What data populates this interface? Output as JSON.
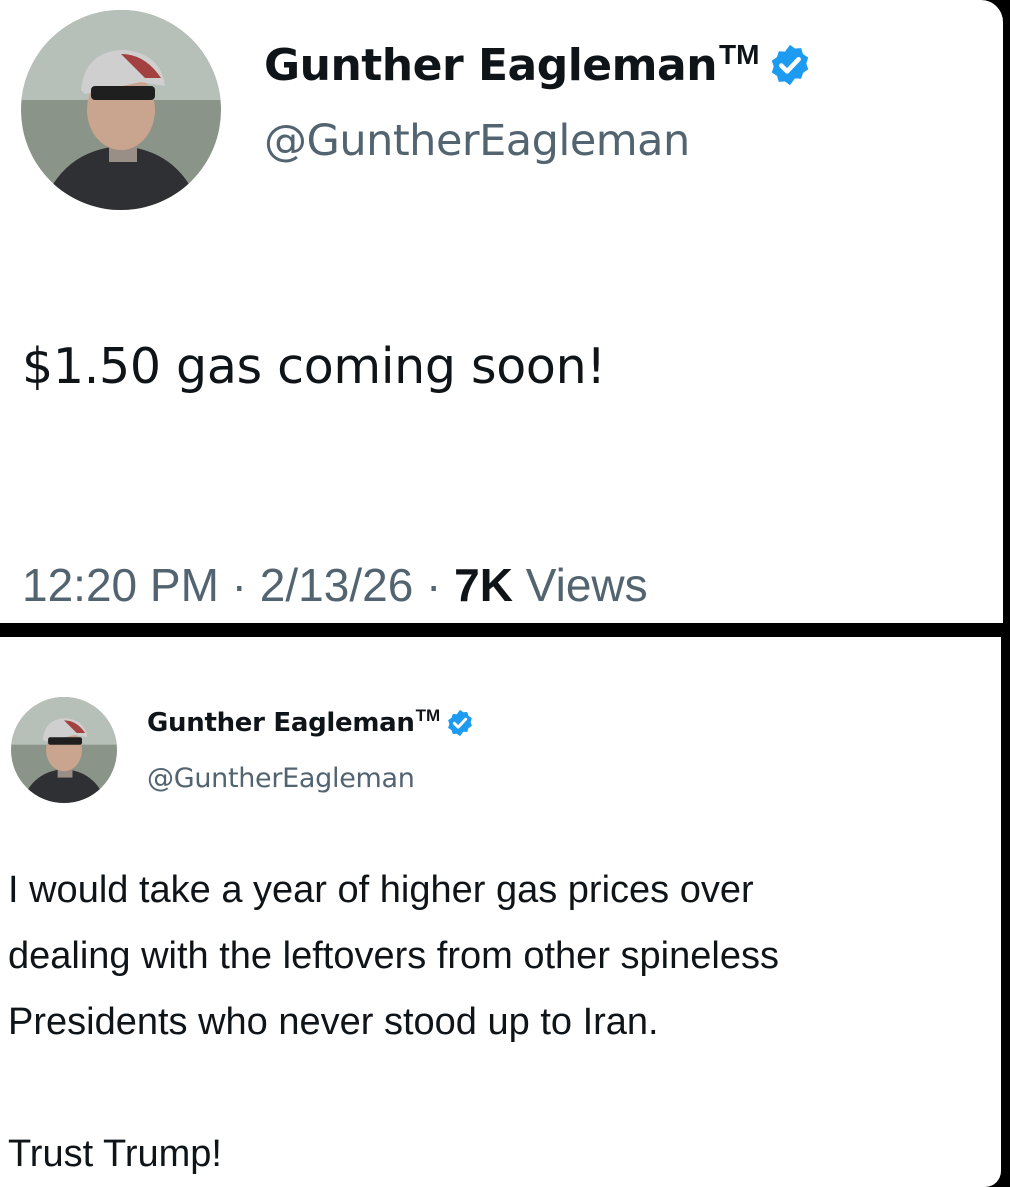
{
  "tweets": [
    {
      "author": {
        "display_name": "Gunther Eagleman",
        "tm": "TM",
        "handle": "@GuntherEagleman",
        "verified_icon": "verified-badge-icon"
      },
      "text": "$1.50 gas coming soon!",
      "meta": {
        "time": "12:20 PM",
        "sep1": " · ",
        "date": "2/13/26",
        "sep2": " · ",
        "views_count": "7K",
        "views_label": " Views"
      }
    },
    {
      "author": {
        "display_name": "Gunther Eagleman",
        "tm": "TM",
        "handle": "@GuntherEagleman",
        "verified_icon": "verified-badge-icon"
      },
      "text_lines": [
        "I would take a year of higher gas prices over",
        "dealing with the leftovers from other spineless",
        "Presidents who never stood up to Iran."
      ],
      "closing": "Trust Trump!"
    }
  ],
  "colors": {
    "verified_blue": "#1d9bf0",
    "text_primary": "#0f1419",
    "text_secondary": "#536471",
    "divider": "#000000"
  }
}
